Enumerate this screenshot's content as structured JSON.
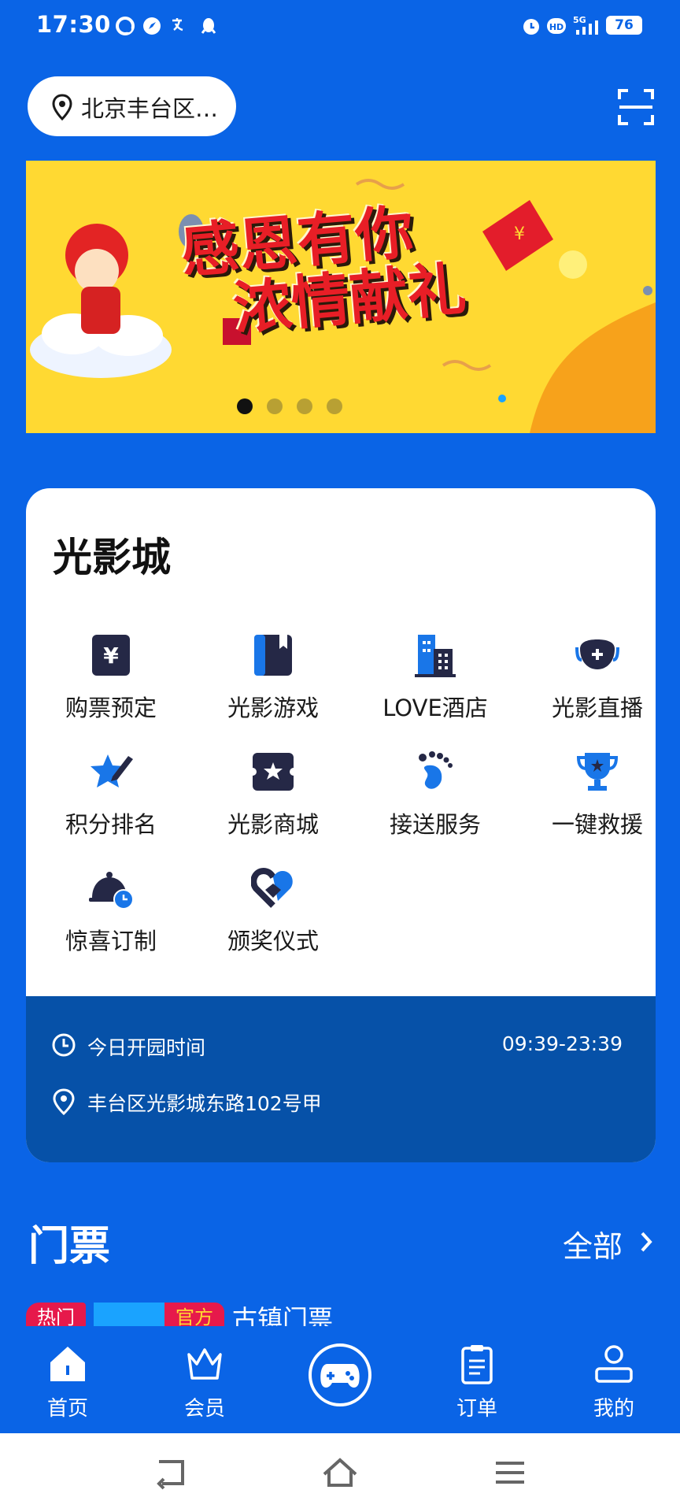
{
  "status_bar": {
    "time": "17:30",
    "battery": "76",
    "right_icons": [
      "alarm-icon",
      "hd-icon",
      "5g-signal-icon"
    ],
    "left_icons": [
      "app-notification-icon",
      "compass-icon",
      "translate-icon",
      "qq-icon"
    ]
  },
  "header": {
    "location": "北京丰台区…",
    "scan_icon": "scan-icon"
  },
  "banner": {
    "title_line1": "感恩有你",
    "title_line2": "浓情献礼",
    "dots": 4,
    "active_dot": 0
  },
  "park": {
    "title": "光影城",
    "items": [
      {
        "label": "购票预定",
        "icon": "yen-ticket-icon"
      },
      {
        "label": "光影游戏",
        "icon": "book-icon"
      },
      {
        "label": "LOVE酒店",
        "icon": "hotel-building-icon"
      },
      {
        "label": "光影直播",
        "icon": "mask-live-icon"
      },
      {
        "label": "积分排名",
        "icon": "star-pencil-icon"
      },
      {
        "label": "光影商城",
        "icon": "star-ticket-icon"
      },
      {
        "label": "接送服务",
        "icon": "footprint-icon"
      },
      {
        "label": "一键救援",
        "icon": "trophy-icon"
      },
      {
        "label": "惊喜订制",
        "icon": "cloche-clock-icon"
      },
      {
        "label": "颁奖仪式",
        "icon": "heart-award-icon"
      }
    ],
    "hours_label": "今日开园时间",
    "hours_value": "09:39-23:39",
    "address": "丰台区光影城东路102号甲"
  },
  "tickets": {
    "title": "门票",
    "all_label": "全部",
    "tag_hot": "热门",
    "tag_official": "官方",
    "first_item": "古镇门票"
  },
  "tab_bar": {
    "items": [
      {
        "label": "首页",
        "icon": "home-icon"
      },
      {
        "label": "会员",
        "icon": "crown-icon"
      },
      {
        "label": "",
        "icon": "gamepad-icon"
      },
      {
        "label": "订单",
        "icon": "clipboard-icon"
      },
      {
        "label": "我的",
        "icon": "user-icon"
      }
    ]
  },
  "colors": {
    "primary": "#0a64e6",
    "info_panel": "#0651a8",
    "banner_bg": "#ffd932",
    "accent_red": "#e81e26",
    "icon_dark": "#252846",
    "icon_blue": "#1976e8"
  }
}
